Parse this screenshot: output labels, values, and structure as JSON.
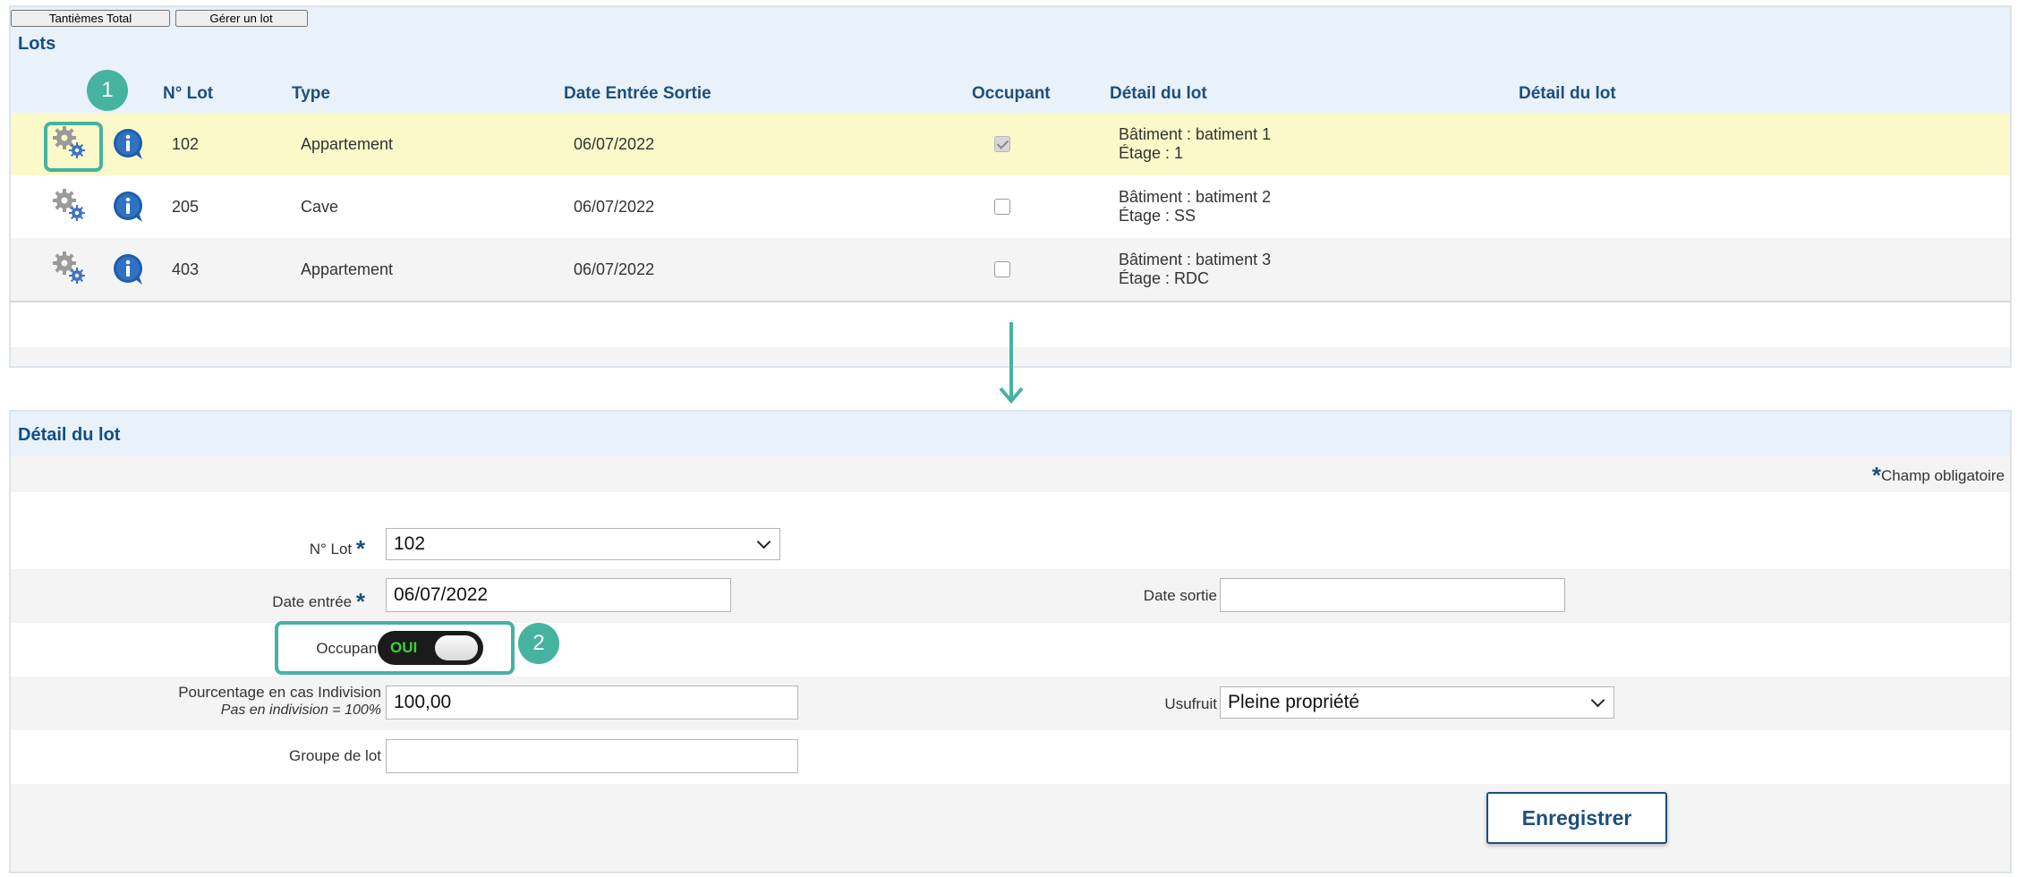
{
  "lots": {
    "title": "Lots",
    "buttons": {
      "tantiemes": "Tantièmes Total",
      "gerer": "Gérer un lot"
    },
    "columns": [
      "N° Lot",
      "Type",
      "Date Entrée Sortie",
      "Occupant",
      "Détail du lot",
      "Détail du lot"
    ],
    "rows": [
      {
        "num": "102",
        "type": "Appartement",
        "date": "06/07/2022",
        "occupant": true,
        "batiment": "Bâtiment : batiment 1",
        "etage": "Étage : 1"
      },
      {
        "num": "205",
        "type": "Cave",
        "date": "06/07/2022",
        "occupant": false,
        "batiment": "Bâtiment : batiment 2",
        "etage": "Étage : SS"
      },
      {
        "num": "403",
        "type": "Appartement",
        "date": "06/07/2022",
        "occupant": false,
        "batiment": "Bâtiment : batiment 3",
        "etage": "Étage : RDC"
      }
    ]
  },
  "markers": {
    "one": "1",
    "two": "2"
  },
  "colors": {
    "accent": "#45b3a0",
    "header_text": "#1d4f7c",
    "highlight_row": "#fbf9c9",
    "toggle_on_text": "#39d138"
  },
  "icons": {
    "settings": "gear-icon",
    "info": "info-icon",
    "arrow": "arrow-down-icon",
    "dropdown": "chevron-down-icon"
  },
  "detail": {
    "title": "Détail du lot",
    "required_note": "Champ obligatoire",
    "required_mark": "*",
    "num_lot": {
      "label": "N° Lot",
      "value": "102"
    },
    "date_entree": {
      "label": "Date entrée",
      "value": "06/07/2022"
    },
    "date_sortie": {
      "label": "Date sortie",
      "value": ""
    },
    "occupant": {
      "label": "Occupant",
      "toggle_text": "OUI",
      "on": true
    },
    "pourcentage": {
      "label": "Pourcentage en cas Indivision",
      "hint": "Pas en indivision = 100%",
      "value": "100,00"
    },
    "usufruit": {
      "label": "Usufruit",
      "value": "Pleine propriété"
    },
    "groupe": {
      "label": "Groupe de lot",
      "value": ""
    },
    "save_label": "Enregistrer"
  }
}
